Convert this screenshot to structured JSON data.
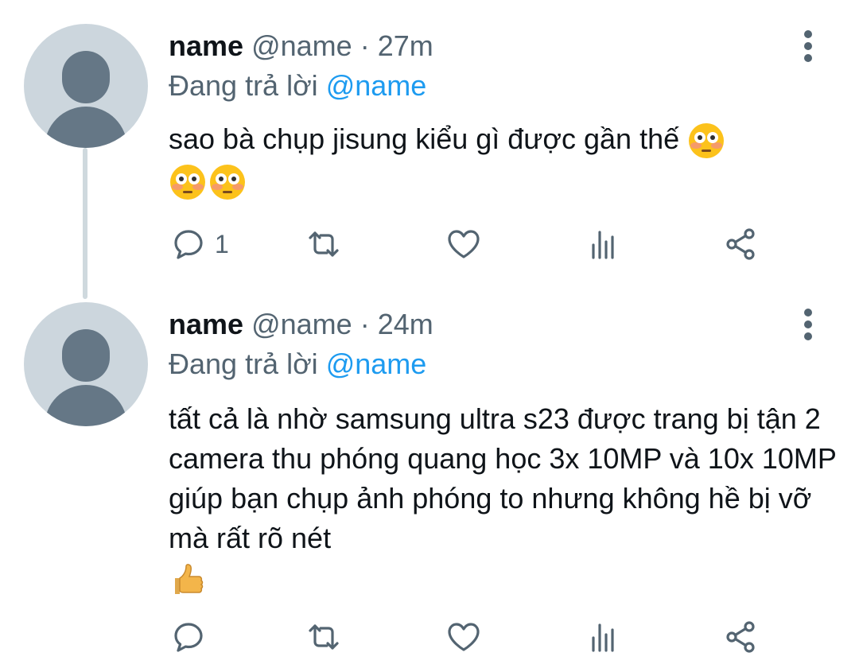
{
  "tweets": [
    {
      "name": "name",
      "handle": "@name",
      "separator": "·",
      "time": "27m",
      "reply_prefix": "Đang trả lời",
      "reply_to": "@name",
      "text": "sao bà chụp jisung kiểu gì được gần thế",
      "emojis": [
        "flushed-face",
        "flushed-face",
        "flushed-face"
      ],
      "reply_count": "1"
    },
    {
      "name": "name",
      "handle": "@name",
      "separator": "·",
      "time": "24m",
      "reply_prefix": "Đang trả lời",
      "reply_to": "@name",
      "text": "tất cả là nhờ samsung ultra s23 được trang bị tận 2 camera thu phóng quang học 3x 10MP và 10x 10MP giúp bạn chụp ảnh phóng to nhưng không hề bị vỡ mà rất rõ nét",
      "emojis": [
        "thumbs-up"
      ],
      "reply_count": ""
    }
  ],
  "icons": [
    "reply-icon",
    "retweet-icon",
    "like-icon",
    "views-icon",
    "share-icon",
    "more-options-icon"
  ],
  "colors": {
    "accent": "#1d9bf0",
    "secondary_text": "#536471",
    "avatar_bg": "#ccd6dd",
    "thread_line": "#cfd9de"
  }
}
